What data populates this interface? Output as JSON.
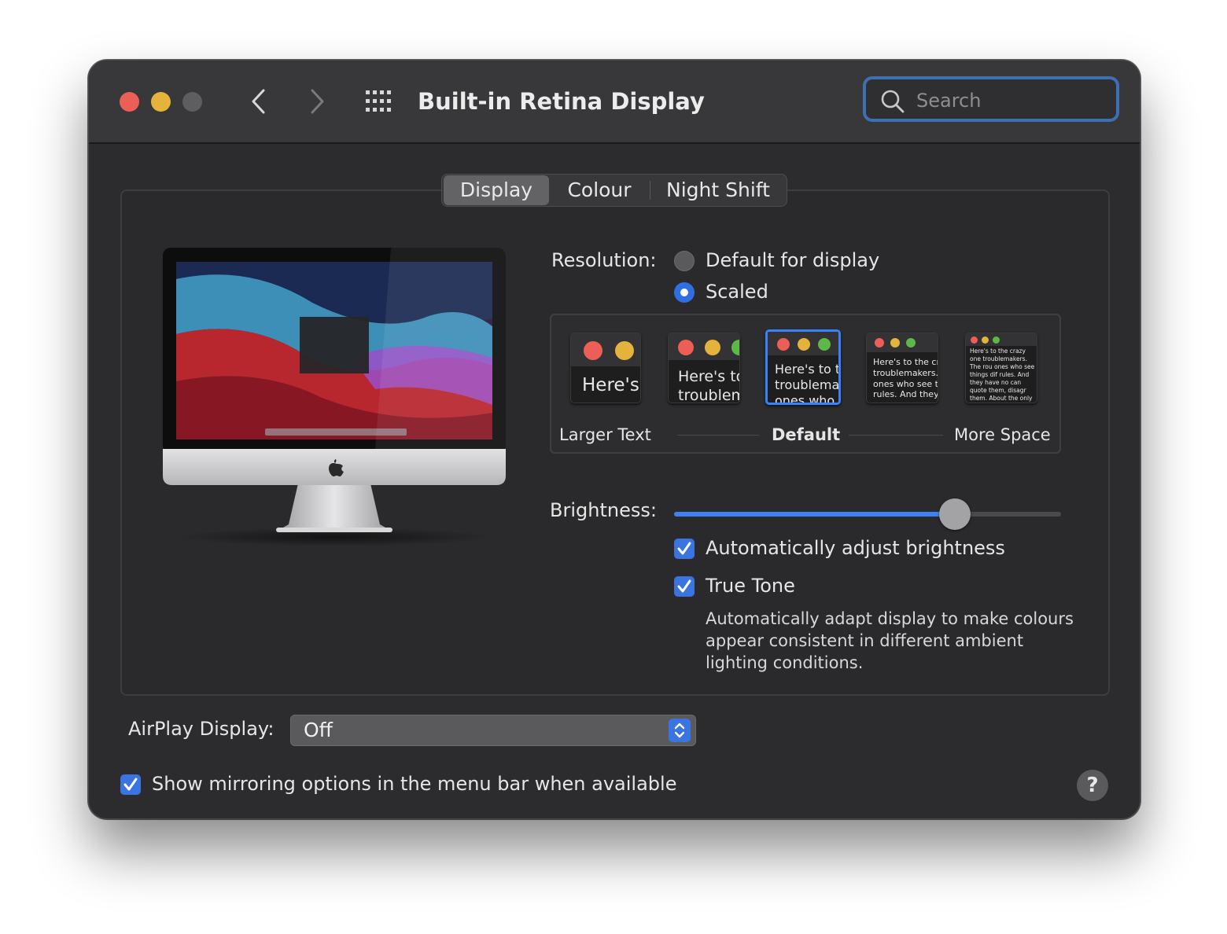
{
  "window": {
    "title": "Built-in Retina Display",
    "search_placeholder": "Search"
  },
  "tabs": [
    {
      "label": "Display"
    },
    {
      "label": "Colour"
    },
    {
      "label": "Night Shift"
    }
  ],
  "resolution": {
    "label": "Resolution:",
    "options": [
      {
        "label": "Default for display",
        "selected": false
      },
      {
        "label": "Scaled",
        "selected": true
      }
    ],
    "scales": {
      "larger": "Larger Text",
      "default": "Default",
      "more": "More Space",
      "samples": [
        "Here's",
        "Here's to troublem",
        "Here's to t troublema ones who",
        "Here's to the cr troublemakers. ones who see t rules. And they",
        "Here's to the crazy one troublemakers. The rou ones who see things dif rules. And they have no can quote them, disagr them. About the only th Because they change th"
      ]
    }
  },
  "brightness": {
    "label": "Brightness:",
    "level": 0.725,
    "auto_label": "Automatically adjust brightness",
    "auto_checked": true
  },
  "true_tone": {
    "label": "True Tone",
    "checked": true,
    "description": "Automatically adapt display to make colours appear consistent in different ambient lighting conditions."
  },
  "airplay": {
    "label": "AirPlay Display:",
    "value": "Off"
  },
  "mirroring": {
    "label": "Show mirroring options in the menu bar when available",
    "checked": true
  },
  "help": "?",
  "colors": {
    "accent": "#3a82f7",
    "close": "#ec5f57",
    "minimize": "#e3b33b",
    "traffic_green": "#5db848"
  }
}
